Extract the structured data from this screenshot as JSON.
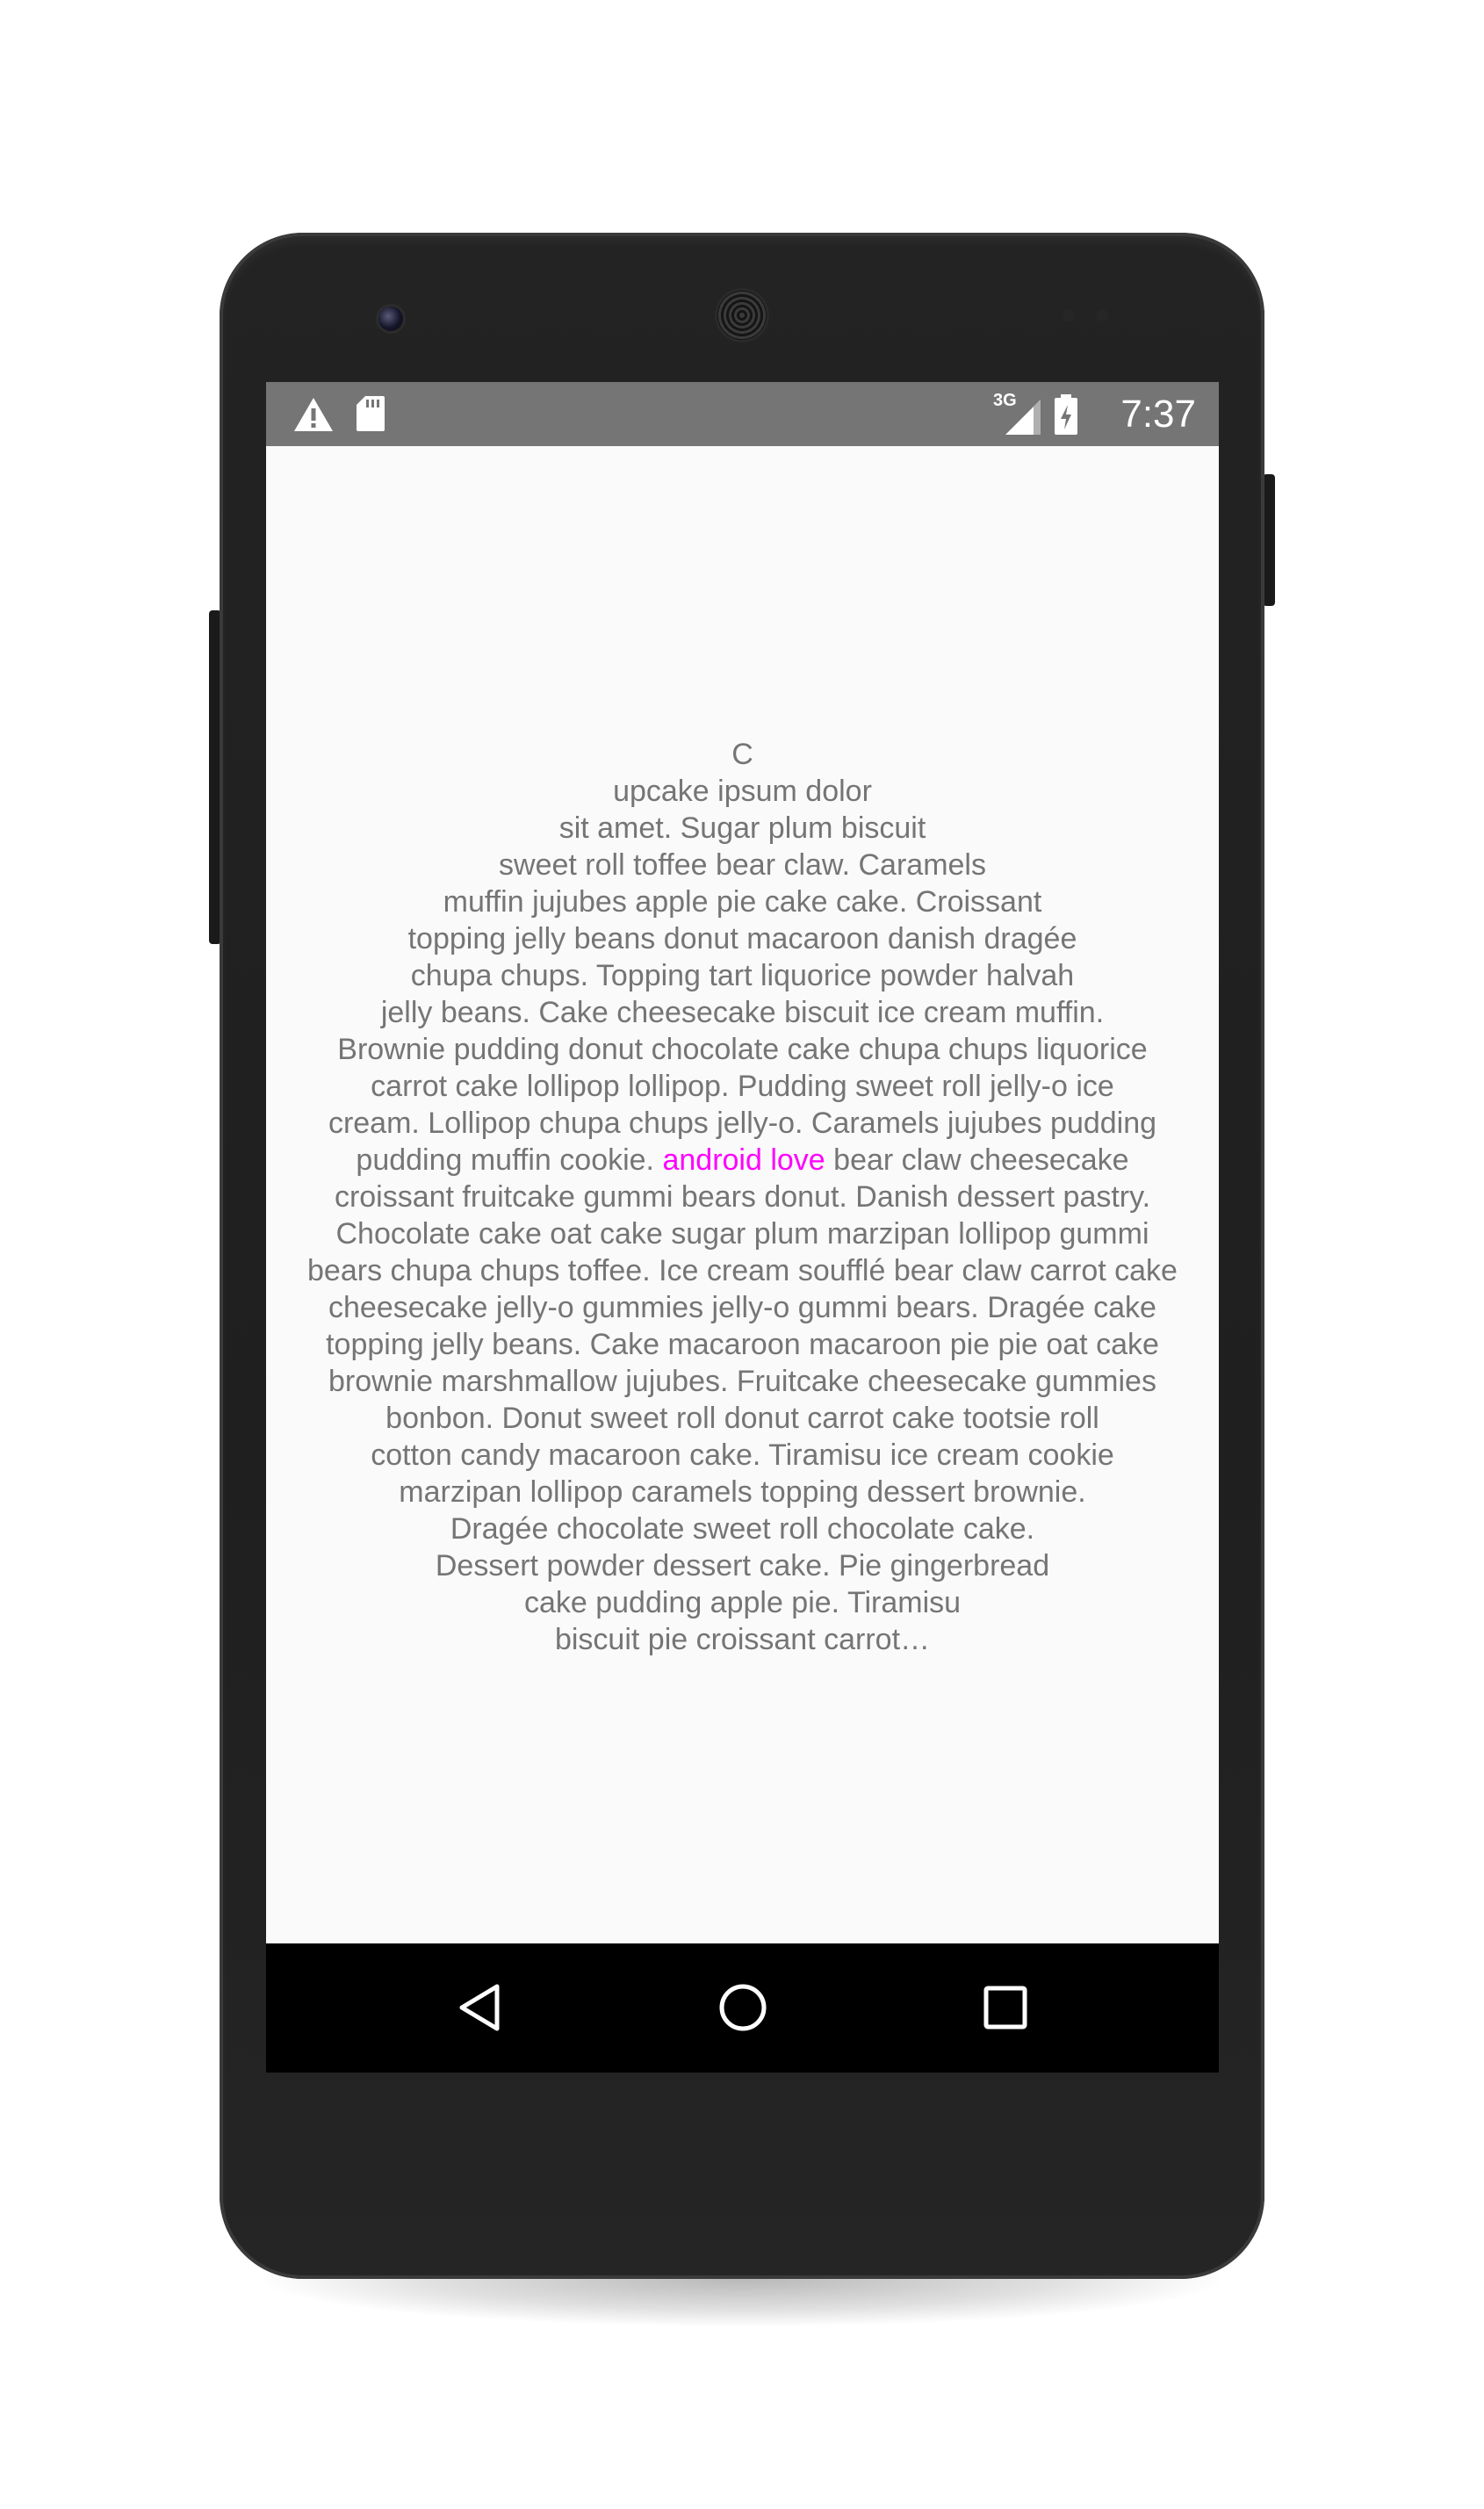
{
  "status_bar": {
    "time": "7:37",
    "network_label": "3G",
    "icons": [
      "warning-icon",
      "sd-card-icon",
      "signal-3g-icon",
      "battery-charging-icon"
    ]
  },
  "content": {
    "lines": [
      "C",
      "upcake ipsum dolor",
      "sit amet. Sugar plum biscuit",
      "sweet roll toffee bear claw. Caramels",
      "muffin jujubes apple pie cake cake. Croissant",
      "topping jelly beans donut macaroon danish dragée",
      "chupa chups. Topping tart liquorice powder halvah",
      "jelly beans. Cake cheesecake biscuit ice cream muffin.",
      "Brownie pudding donut chocolate cake chupa chups liquorice",
      "carrot cake lollipop lollipop. Pudding sweet roll jelly-o ice",
      "cream. Lollipop chupa chups jelly-o. Caramels jujubes pudding"
    ],
    "highlight_line": {
      "before": "pudding muffin cookie. ",
      "highlight": "android love",
      "after": " bear claw cheesecake"
    },
    "lines_after": [
      "croissant fruitcake gummi bears donut. Danish dessert pastry.",
      "Chocolate cake oat cake sugar plum marzipan lollipop gummi",
      "bears chupa chups toffee. Ice cream soufflé bear claw carrot cake",
      "cheesecake jelly-o gummies jelly-o gummi bears. Dragée cake",
      "topping jelly beans. Cake macaroon macaroon pie pie oat cake",
      "brownie marshmallow jujubes. Fruitcake cheesecake gummies",
      "bonbon. Donut sweet roll donut carrot cake tootsie roll",
      "cotton candy macaroon cake. Tiramisu ice cream cookie",
      "marzipan lollipop caramels topping dessert brownie.",
      "Dragée chocolate sweet roll chocolate cake.",
      "Dessert powder dessert cake. Pie gingerbread",
      "cake pudding apple pie. Tiramisu",
      "biscuit pie croissant carrot…"
    ],
    "text_color": "#757575",
    "highlight_color": "#ff00ff"
  },
  "nav_bar": {
    "buttons": [
      "back-icon",
      "home-icon",
      "recents-icon"
    ]
  },
  "colors": {
    "status_bar": "#757575",
    "screen_background": "#fafafa",
    "nav_bar": "#000000",
    "phone_body": "#222222"
  }
}
